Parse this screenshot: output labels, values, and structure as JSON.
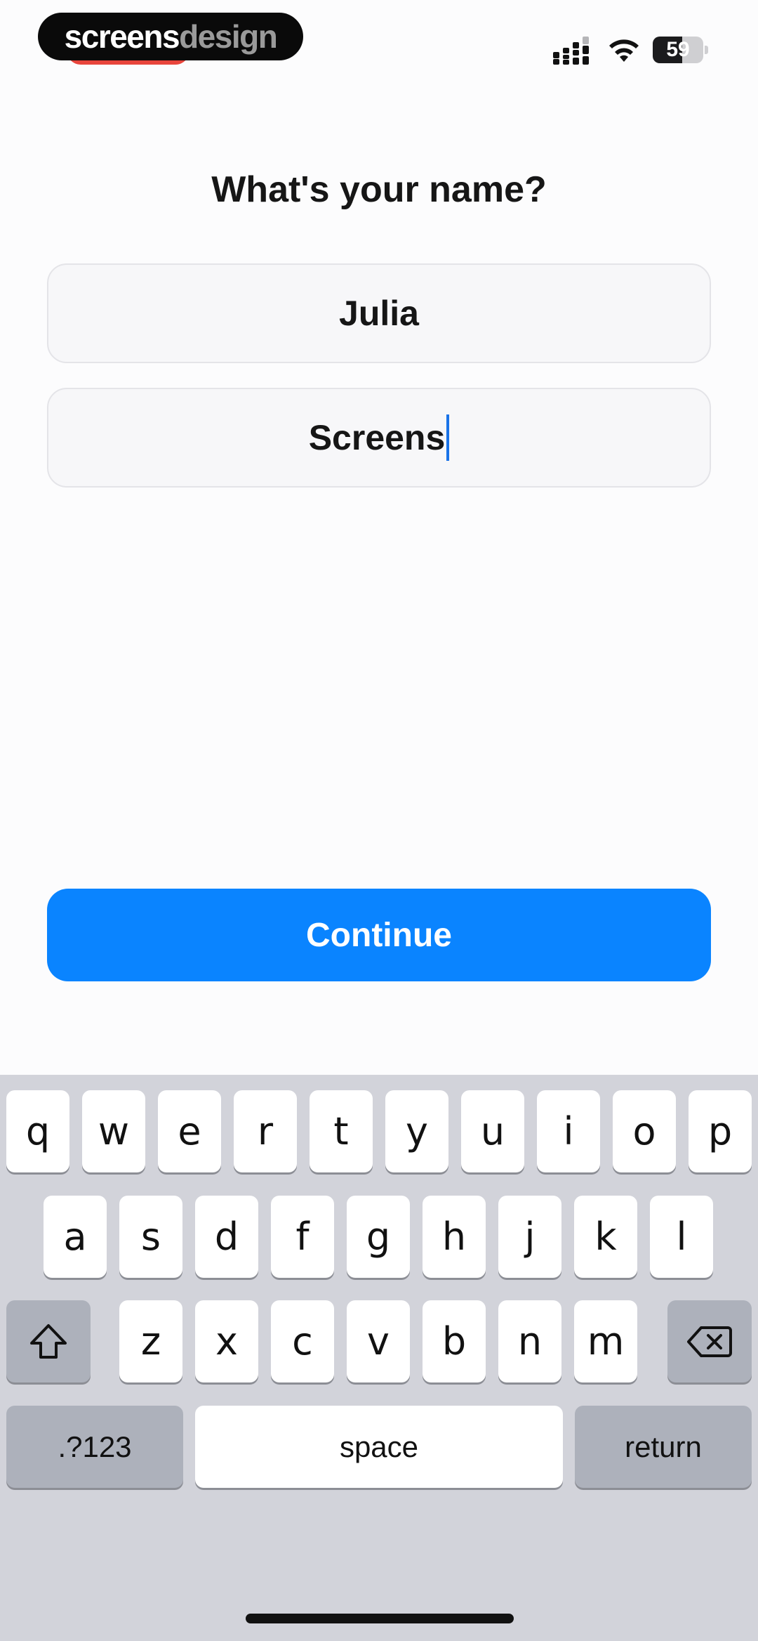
{
  "status_bar": {
    "brand_part1": "screens",
    "brand_part2": "design",
    "battery_level": "59",
    "battery_fraction": 0.59,
    "signal_icon": "cellular-signal-icon",
    "wifi_icon": "wifi-icon"
  },
  "main": {
    "title": "What's your name?",
    "first_name_value": "Julia",
    "last_name_value": "Screens",
    "continue_label": "Continue"
  },
  "keyboard": {
    "row1": [
      "q",
      "w",
      "e",
      "r",
      "t",
      "y",
      "u",
      "i",
      "o",
      "p"
    ],
    "row2": [
      "a",
      "s",
      "d",
      "f",
      "g",
      "h",
      "j",
      "k",
      "l"
    ],
    "row3": [
      "z",
      "x",
      "c",
      "v",
      "b",
      "n",
      "m"
    ],
    "shift_icon": "shift-icon",
    "delete_icon": "backspace-icon",
    "numbers_label": ".?123",
    "space_label": "space",
    "return_label": "return"
  },
  "colors": {
    "accent": "#0a84ff",
    "caret": "#1a73e8",
    "keyboard_bg": "#d2d3da"
  }
}
